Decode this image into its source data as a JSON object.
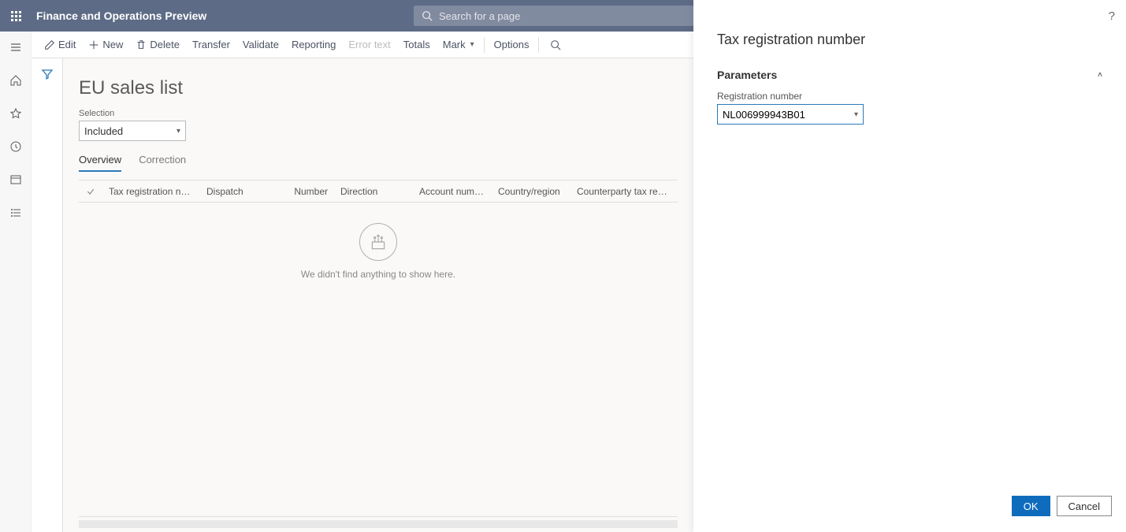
{
  "topbar": {
    "app_title": "Finance and Operations Preview",
    "search_placeholder": "Search for a page"
  },
  "actionbar": {
    "edit": "Edit",
    "new": "New",
    "delete": "Delete",
    "transfer": "Transfer",
    "validate": "Validate",
    "reporting": "Reporting",
    "error_text": "Error text",
    "totals": "Totals",
    "mark": "Mark",
    "options": "Options"
  },
  "page": {
    "title": "EU sales list",
    "selection_label": "Selection",
    "selection_value": "Included",
    "tabs": {
      "overview": "Overview",
      "correction": "Correction"
    },
    "columns": {
      "tax_reg": "Tax registration number",
      "dispatch": "Dispatch",
      "number": "Number",
      "direction": "Direction",
      "account": "Account number",
      "country": "Country/region",
      "ctax": "Counterparty tax registration"
    },
    "empty": "We didn't find anything to show here."
  },
  "panel": {
    "title": "Tax registration number",
    "section": "Parameters",
    "field_label": "Registration number",
    "field_value": "NL006999943B01",
    "ok": "OK",
    "cancel": "Cancel"
  }
}
